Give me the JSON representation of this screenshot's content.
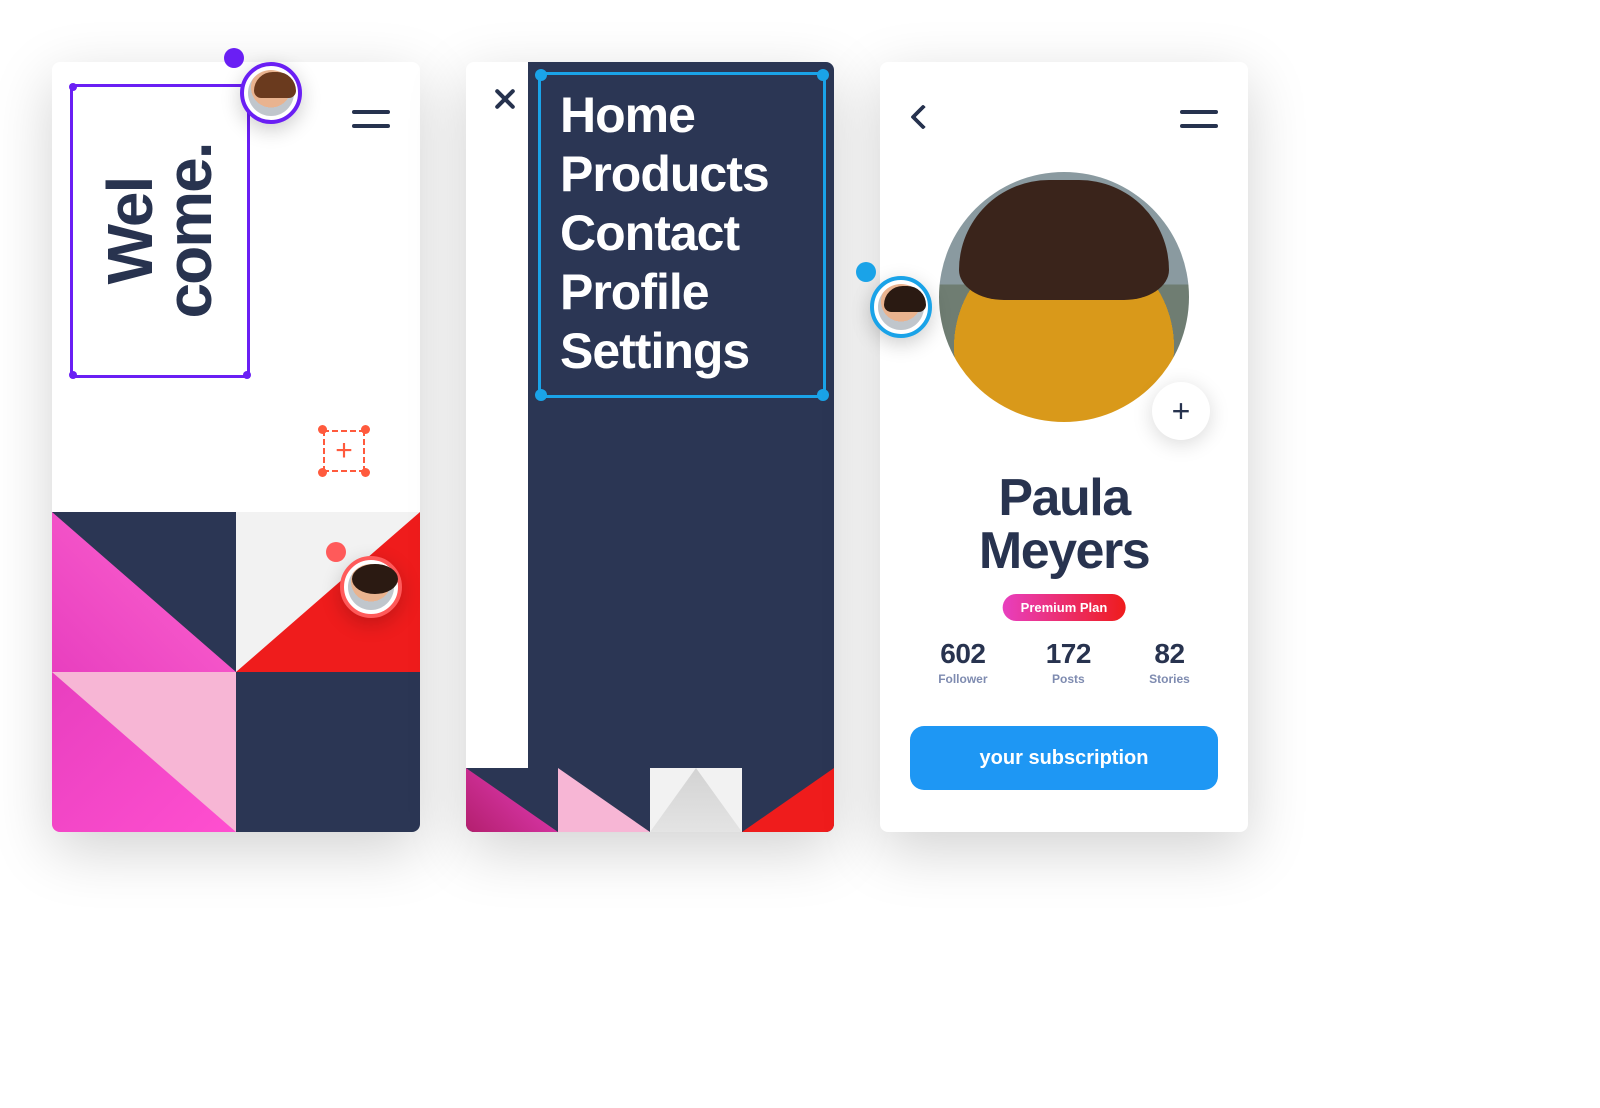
{
  "screen1": {
    "welcome_line1": "Wel",
    "welcome_line2": "come."
  },
  "screen2": {
    "menu": [
      "Home",
      "Products",
      "Contact",
      "Profile",
      "Settings"
    ]
  },
  "screen3": {
    "name_line1": "Paula",
    "name_line2": "Meyers",
    "plan_label": "Premium Plan",
    "stats": [
      {
        "value": "602",
        "label": "Follower"
      },
      {
        "value": "172",
        "label": "Posts"
      },
      {
        "value": "82",
        "label": "Stories"
      }
    ],
    "cta": "your subscription"
  },
  "cursors": {
    "purple": {
      "color": "#6a1ff4"
    },
    "red": {
      "color": "#ff5a5a"
    },
    "blue": {
      "color": "#1aa3e8"
    }
  },
  "icons": {
    "plus": "+"
  }
}
